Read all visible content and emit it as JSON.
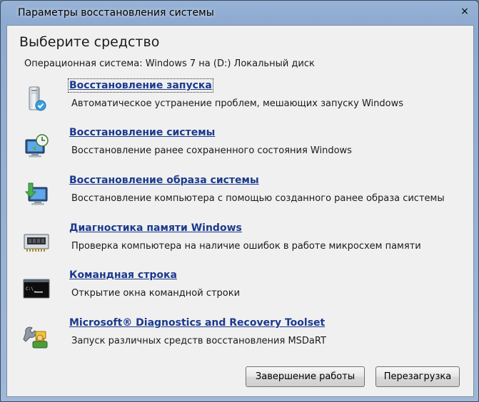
{
  "window": {
    "title": "Параметры восстановления системы",
    "close_glyph": "×"
  },
  "header": {
    "heading": "Выберите средство",
    "os_line": "Операционная система: Windows 7 на (D:) Локальный диск"
  },
  "tools": [
    {
      "label": "Восстановление запуска",
      "description": "Автоматическое устранение проблем, мешающих запуску Windows",
      "icon": "startup-repair-icon"
    },
    {
      "label": "Восстановление системы",
      "description": "Восстановление ранее сохраненного состояния Windows",
      "icon": "system-restore-icon"
    },
    {
      "label": "Восстановление образа системы",
      "description": "Восстановление компьютера с помощью  созданного ранее образа системы",
      "icon": "system-image-icon"
    },
    {
      "label": "Диагностика памяти Windows",
      "description": "Проверка компьютера на наличие ошибок в работе микросхем памяти",
      "icon": "memory-chip-icon"
    },
    {
      "label": "Командная строка",
      "description": "Открытие окна командной строки",
      "icon": "command-prompt-icon"
    },
    {
      "label": "Microsoft® Diagnostics and Recovery Toolset",
      "description": "Запуск различных средств восстановления MSDaRT",
      "icon": "toolset-icon"
    }
  ],
  "buttons": {
    "shutdown": "Завершение работы",
    "restart": "Перезагрузка"
  },
  "colors": {
    "link": "#1b3a8e",
    "client_bg": "#f0f0f0",
    "frame": "#97b3d6"
  }
}
